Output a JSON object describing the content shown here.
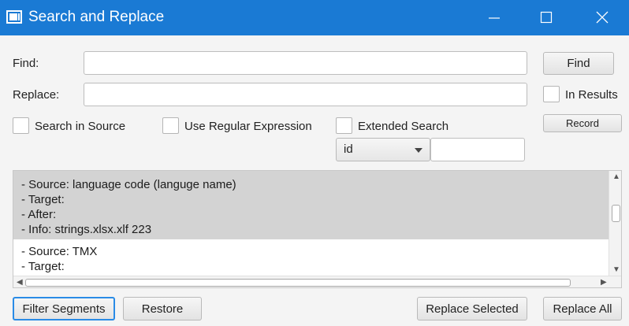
{
  "window": {
    "title": "Search and Replace"
  },
  "form": {
    "find_label": "Find:",
    "find_value": "",
    "replace_label": "Replace:",
    "replace_value": "",
    "search_in_source_label": "Search in Source",
    "search_in_source_checked": false,
    "use_regex_label": "Use Regular Expression",
    "use_regex_checked": false,
    "extended_search_label": "Extended Search",
    "extended_search_checked": false,
    "in_results_label": "In Results",
    "in_results_checked": false,
    "attribute_select_value": "id",
    "attribute_value": ""
  },
  "buttons": {
    "find": "Find",
    "record": "Record",
    "filter_segments": "Filter Segments",
    "restore": "Restore",
    "replace_selected": "Replace Selected",
    "replace_all": "Replace All"
  },
  "results": [
    {
      "lines": [
        "- Source: language code (languge name)",
        "- Target:",
        "- After:",
        "- Info: strings.xlsx.xlf 223"
      ],
      "selected": true
    },
    {
      "lines": [
        "- Source: TMX",
        "- Target:"
      ],
      "selected": false
    }
  ],
  "colors": {
    "titlebar": "#1a7ad4",
    "selection": "#d3d3d3",
    "focus": "#2a8be6"
  },
  "icons": [
    "app-icon",
    "minimize-icon",
    "maximize-icon",
    "close-icon",
    "chevron-down-icon"
  ]
}
